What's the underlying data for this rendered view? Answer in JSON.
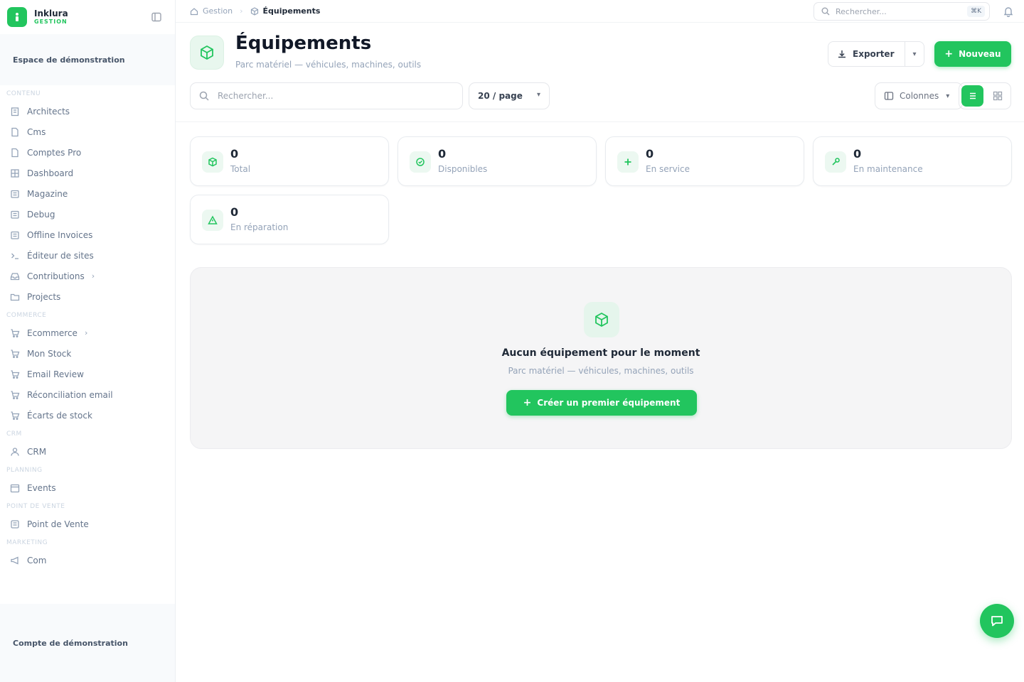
{
  "brand": {
    "name": "Inklura",
    "sub": "GESTION",
    "accent": "#22c55e"
  },
  "sidebar": {
    "workspace": "Espace de démonstration",
    "account": "Compte de démonstration",
    "sections": [
      {
        "title": "CONTENU",
        "items": [
          {
            "label": "Architects",
            "icon": "building-icon"
          },
          {
            "label": "Cms",
            "icon": "file-icon"
          },
          {
            "label": "Comptes Pro",
            "icon": "file-icon"
          },
          {
            "label": "Dashboard",
            "icon": "grid-icon"
          },
          {
            "label": "Magazine",
            "icon": "newspaper-icon"
          },
          {
            "label": "Debug",
            "icon": "newspaper-icon"
          },
          {
            "label": "Offline Invoices",
            "icon": "newspaper-icon"
          },
          {
            "label": "Éditeur de sites",
            "icon": "terminal-icon"
          },
          {
            "label": "Contributions",
            "icon": "inbox-icon",
            "chevron": "›"
          },
          {
            "label": "Projects",
            "icon": "folder-icon"
          }
        ]
      },
      {
        "title": "COMMERCE",
        "items": [
          {
            "label": "Ecommerce",
            "icon": "cart-icon",
            "chevron": "›"
          },
          {
            "label": "Mon Stock",
            "icon": "cart-icon"
          },
          {
            "label": "Email Review",
            "icon": "cart-icon"
          },
          {
            "label": "Réconciliation email",
            "icon": "cart-icon"
          },
          {
            "label": "Écarts de stock",
            "icon": "cart-icon"
          }
        ]
      },
      {
        "title": "CRM",
        "items": [
          {
            "label": "CRM",
            "icon": "user-icon"
          }
        ]
      },
      {
        "title": "PLANNING",
        "items": [
          {
            "label": "Events",
            "icon": "calendar-icon"
          }
        ]
      },
      {
        "title": "POINT DE VENTE",
        "items": [
          {
            "label": "Point de Vente",
            "icon": "register-icon"
          }
        ]
      },
      {
        "title": "MARKETING",
        "items": [
          {
            "label": "Com",
            "icon": "megaphone-icon"
          }
        ]
      }
    ]
  },
  "topbar": {
    "breadcrumb": [
      "Gestion",
      "Équipements"
    ],
    "search_placeholder": "Rechercher...",
    "shortcut": "⌘K"
  },
  "header": {
    "title": "Équipements",
    "subtitle": "Parc matériel — véhicules, machines, outils",
    "export_label": "Exporter",
    "new_label": "Nouveau"
  },
  "toolbar": {
    "search_placeholder": "Rechercher...",
    "per_page": "20 / page",
    "columns_label": "Colonnes"
  },
  "stats": [
    {
      "value": "0",
      "label": "Total",
      "icon": "box-icon"
    },
    {
      "value": "0",
      "label": "Disponibles",
      "icon": "check-circle-icon"
    },
    {
      "value": "0",
      "label": "En service",
      "icon": "activity-icon"
    },
    {
      "value": "0",
      "label": "En maintenance",
      "icon": "wrench-icon"
    },
    {
      "value": "0",
      "label": "En réparation",
      "icon": "alert-icon"
    }
  ],
  "empty": {
    "title": "Aucun équipement pour le moment",
    "subtitle": "Parc matériel — véhicules, machines, outils",
    "cta": "Créer un premier équipement"
  }
}
